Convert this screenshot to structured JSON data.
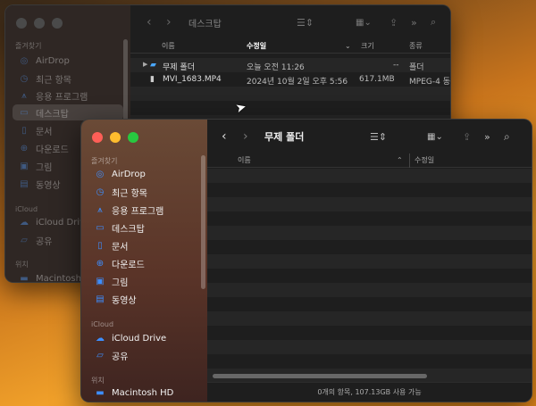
{
  "back_window": {
    "title": "데스크탑",
    "sidebar": {
      "favorites_header": "즐겨찾기",
      "items": [
        {
          "label": "AirDrop",
          "icon": "airdrop-icon"
        },
        {
          "label": "최근 항목",
          "icon": "clock-icon"
        },
        {
          "label": "응용 프로그램",
          "icon": "applications-icon"
        },
        {
          "label": "데스크탑",
          "icon": "desktop-icon"
        },
        {
          "label": "문서",
          "icon": "document-icon"
        },
        {
          "label": "다운로드",
          "icon": "download-icon"
        },
        {
          "label": "그림",
          "icon": "picture-icon"
        },
        {
          "label": "동영상",
          "icon": "movie-icon"
        }
      ],
      "icloud_header": "iCloud",
      "icloud_items": [
        {
          "label": "iCloud Drive",
          "icon": "cloud-icon"
        },
        {
          "label": "공유",
          "icon": "shared-folder-icon"
        }
      ],
      "locations_header": "위치",
      "locations_items": [
        {
          "label": "Macintosh HD",
          "icon": "disk-icon"
        }
      ]
    },
    "columns": {
      "name": "이름",
      "modified": "수정일",
      "size": "크기",
      "kind": "종류"
    },
    "rows": [
      {
        "name": "무제 폴더",
        "modified": "오늘 오전 11:26",
        "size": "--",
        "kind": "폴더",
        "icon": "folder-icon"
      },
      {
        "name": "MVI_1683.MP4",
        "modified": "2024년 10월 2일 오후 5:56",
        "size": "617.1MB",
        "kind": "MPEG-4 동",
        "icon": "video-file-icon"
      }
    ]
  },
  "front_window": {
    "title": "무제 폴더",
    "sidebar": {
      "favorites_header": "즐겨찾기",
      "items": [
        {
          "label": "AirDrop",
          "icon": "airdrop-icon"
        },
        {
          "label": "최근 항목",
          "icon": "clock-icon"
        },
        {
          "label": "응용 프로그램",
          "icon": "applications-icon"
        },
        {
          "label": "데스크탑",
          "icon": "desktop-icon"
        },
        {
          "label": "문서",
          "icon": "document-icon"
        },
        {
          "label": "다운로드",
          "icon": "download-icon"
        },
        {
          "label": "그림",
          "icon": "picture-icon"
        },
        {
          "label": "동영상",
          "icon": "movie-icon"
        }
      ],
      "icloud_header": "iCloud",
      "icloud_items": [
        {
          "label": "iCloud Drive",
          "icon": "cloud-icon"
        },
        {
          "label": "공유",
          "icon": "shared-folder-icon"
        }
      ],
      "locations_header": "위치",
      "locations_items": [
        {
          "label": "Macintosh HD",
          "icon": "disk-icon"
        }
      ]
    },
    "columns": {
      "name": "이름",
      "modified": "수정일"
    },
    "status": "0개의 항목, 107.13GB 사용 가능"
  },
  "colors": {
    "accent": "#3d8eff",
    "close": "#ff5f57",
    "minimize": "#febc2e",
    "zoom": "#28c840"
  }
}
